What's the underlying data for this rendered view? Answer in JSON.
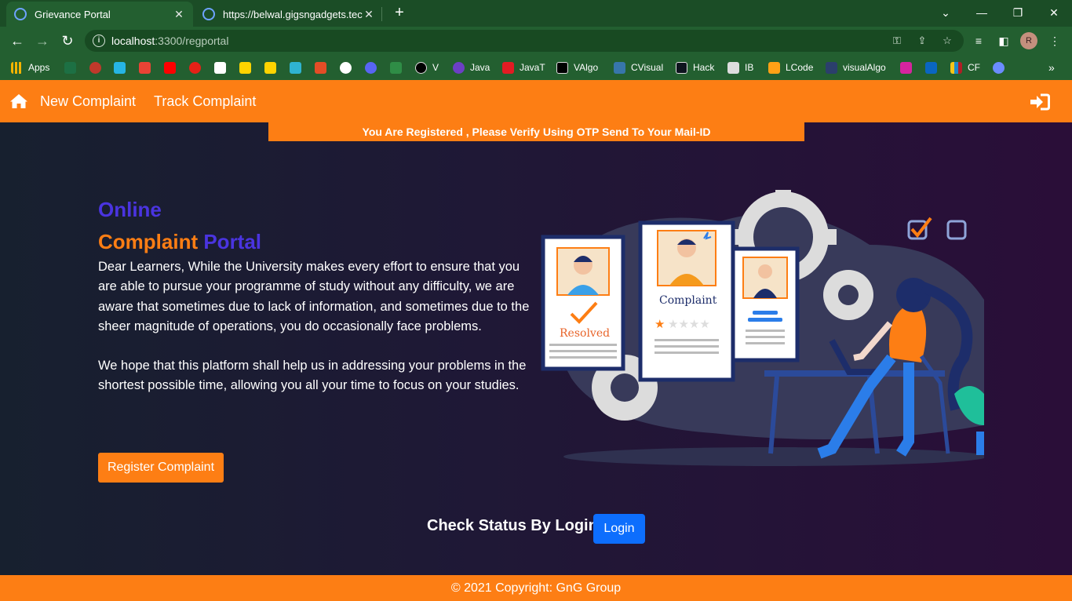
{
  "browser": {
    "tabs": [
      {
        "title": "Grievance Portal"
      },
      {
        "title": "https://belwal.gigsngadgets.tech/"
      }
    ],
    "url": {
      "host": "localhost",
      "path": ":3300/regportal"
    },
    "profile_initial": "R",
    "bookmarks": [
      {
        "label": "Apps",
        "color": "#f4b400"
      },
      {
        "label": "",
        "color": "#1d7044"
      },
      {
        "label": "",
        "color": "#c0392b"
      },
      {
        "label": "",
        "color": "#26b5e4"
      },
      {
        "label": "",
        "color": "#ea4335"
      },
      {
        "label": "",
        "color": "#ff0000"
      },
      {
        "label": "",
        "color": "#e62117"
      },
      {
        "label": "",
        "color": "#ffffff"
      },
      {
        "label": "",
        "color": "#ffd400"
      },
      {
        "label": "",
        "color": "#ffd400"
      },
      {
        "label": "",
        "color": "#2fb3d2"
      },
      {
        "label": "",
        "color": "#e44d26"
      },
      {
        "label": "",
        "color": "#ffffff"
      },
      {
        "label": "",
        "color": "#5865f2"
      },
      {
        "label": "",
        "color": "#2f8d46"
      },
      {
        "label": "V",
        "color": "#000000"
      },
      {
        "label": "Java",
        "color": "#6c3fc5"
      },
      {
        "label": "JavaT",
        "color": "#e31b23"
      },
      {
        "label": "VAlgo",
        "color": "#000000"
      },
      {
        "label": "CVisual",
        "color": "#3776ab"
      },
      {
        "label": "Hack",
        "color": "#0e141e"
      },
      {
        "label": "IB",
        "color": "#dddddd"
      },
      {
        "label": "LCode",
        "color": "#ffa116"
      },
      {
        "label": "visualAlgo",
        "color": "#2b3f6c"
      },
      {
        "label": "",
        "color": "#d6249f"
      },
      {
        "label": "",
        "color": "#0a66c2"
      },
      {
        "label": "CF",
        "color": "#f5c518"
      },
      {
        "label": "",
        "color": "#6b8cff"
      }
    ]
  },
  "site": {
    "nav": {
      "new_complaint": "New Complaint",
      "track_complaint": "Track Complaint"
    },
    "alert": "You Are Registered , Please Verify Using OTP Send To Your Mail-ID",
    "hero": {
      "online": "Online",
      "title_a": "Complaint",
      "title_b": "Portal",
      "para1": "Dear Learners, While the University makes every effort to ensure that you are able to pursue your programme of study without any difficulty, we are aware that sometimes due to lack of information, and sometimes due to the sheer magnitude of operations, you do occasionally face problems.",
      "para2": "We hope that this platform shall help us in addressing your problems in the shortest possible time, allowing you all your time to focus on your studies.",
      "register_btn": "Register Complaint"
    },
    "illustration": {
      "card_resolved": "Resolved",
      "card_complaint": "Complaint"
    },
    "status": {
      "label": "Check Status By Login",
      "login_btn": "Login"
    },
    "footer": "© 2021 Copyright: GnG Group",
    "colors": {
      "accent": "#fd7e14",
      "primary": "#0d6efd",
      "title_purple": "#4a34e0"
    }
  }
}
